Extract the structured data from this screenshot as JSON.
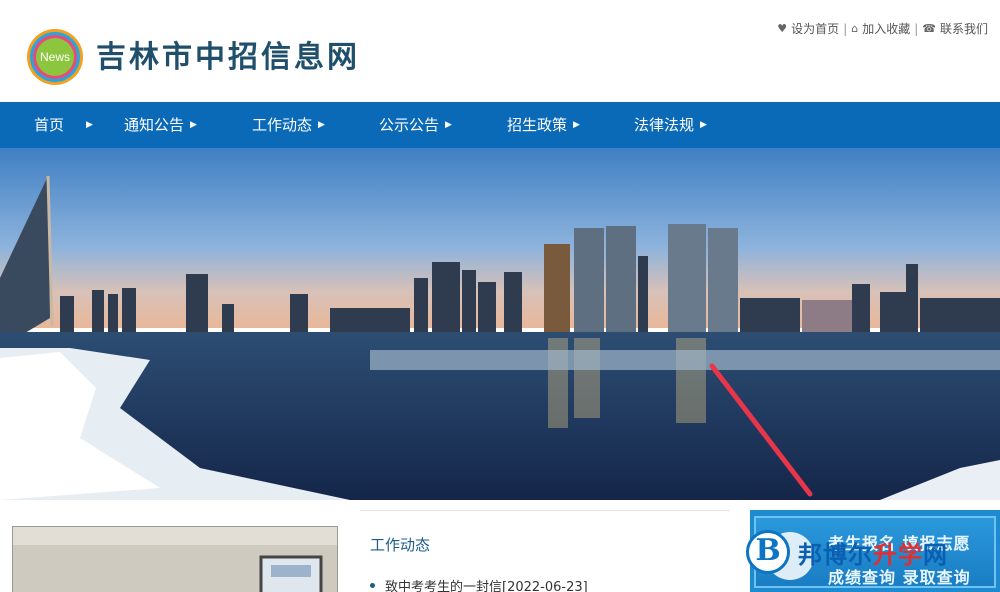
{
  "header": {
    "site_title": "吉林市中招信息网",
    "logo_text": "News",
    "links": [
      {
        "label": "设为首页",
        "icon": "heart-icon"
      },
      {
        "label": "加入收藏",
        "icon": "home-icon"
      },
      {
        "label": "联系我们",
        "icon": "phone-icon"
      }
    ]
  },
  "nav": {
    "items": [
      {
        "label": "首页"
      },
      {
        "label": "通知公告"
      },
      {
        "label": "工作动态"
      },
      {
        "label": "公示公告"
      },
      {
        "label": "招生政策"
      },
      {
        "label": "法律法规"
      }
    ]
  },
  "news": {
    "heading": "工作动态",
    "items": [
      {
        "title": "致中考考生的一封信[2022-06-23]"
      }
    ]
  },
  "side_banner": {
    "line1": "考生报名  填报志愿",
    "line2": "成绩查询  录取查询"
  },
  "watermark": {
    "logo": "B",
    "text_part1": "邦博尔",
    "text_highlight": "升学",
    "text_part2": "网"
  },
  "colors": {
    "nav_bg": "#0b6ab8",
    "title": "#1f4f6b",
    "annotation_arrow": "#e8354a"
  }
}
